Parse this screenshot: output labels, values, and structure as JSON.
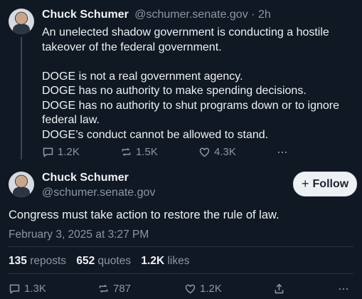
{
  "first_post": {
    "author_name": "Chuck Schumer",
    "handle": "@schumer.senate.gov",
    "separator": "·",
    "time": "2h",
    "text_lines": [
      "An unelected shadow government is conducting a hostile",
      "takeover of the federal government.",
      "",
      "DOGE is not a real government agency.",
      "DOGE has no authority to make spending decisions.",
      "DOGE has no authority to shut programs down or to ignore",
      "federal law.",
      "DOGE’s conduct cannot be allowed to stand."
    ],
    "replies": "1.2K",
    "reposts": "1.5K",
    "likes": "4.3K",
    "more": "···"
  },
  "main_post": {
    "author_name": "Chuck Schumer",
    "handle": "@schumer.senate.gov",
    "follow_label": "Follow",
    "follow_icon": "+",
    "text": "Congress must take action to restore the rule of law.",
    "timestamp": "February 3, 2025 at 3:27 PM",
    "stats": {
      "reposts_count": "135",
      "reposts_label": "reposts",
      "quotes_count": "652",
      "quotes_label": "quotes",
      "likes_count": "1.2K",
      "likes_label": "likes"
    },
    "actions": {
      "replies": "1.3K",
      "reposts": "787",
      "likes": "1.2K",
      "more": "···"
    }
  },
  "colors": {
    "background": "#101823",
    "muted_text": "#8a97a5",
    "divider": "#28323d"
  }
}
